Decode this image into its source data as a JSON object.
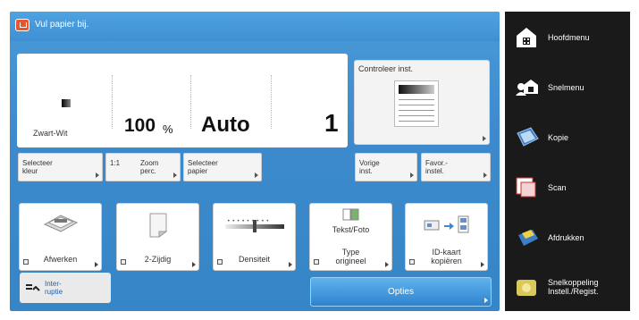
{
  "status_message": "Vul papier bij.",
  "settings": {
    "color": "Zwart-Wit",
    "zoom_value": "100",
    "zoom_unit": "%",
    "paper": "Auto",
    "copies": "1"
  },
  "check_button": "Controleer inst.",
  "quick_buttons": [
    {
      "l1": "Selecteer",
      "l2": "kleur"
    },
    {
      "l1": "1:1",
      "l2": ""
    },
    {
      "l1": "Zoom",
      "l2": "perc."
    },
    {
      "l1": "Selecteer",
      "l2": "papier"
    },
    {
      "l1": "Vorige",
      "l2": "inst."
    },
    {
      "l1": "Favor.-",
      "l2": "instel."
    }
  ],
  "function_buttons": [
    {
      "l1": "Afwerken",
      "l2": ""
    },
    {
      "l1": "2-Zijdig",
      "l2": ""
    },
    {
      "l1": "Densiteit",
      "l2": ""
    },
    {
      "l1": "Type",
      "l2": "origineel",
      "top": "Tekst/Foto"
    },
    {
      "l1": "ID-kaart",
      "l2": "kopiëren"
    }
  ],
  "interrupt": {
    "l1": "Inter-",
    "l2": "ruptie"
  },
  "options_button": "Opties",
  "side_menu": [
    {
      "label": "Hoofdmenu",
      "label2": ""
    },
    {
      "label": "Snelmenu",
      "label2": ""
    },
    {
      "label": "Kopie",
      "label2": ""
    },
    {
      "label": "Scan",
      "label2": ""
    },
    {
      "label": "Afdrukken",
      "label2": ""
    },
    {
      "label": "Snelkoppeling",
      "label2": "Instell./Regist."
    }
  ],
  "colors": {
    "accent_blue": "#3d8bcd",
    "side_bg": "#1a1a1a",
    "alert": "#e9562d"
  }
}
